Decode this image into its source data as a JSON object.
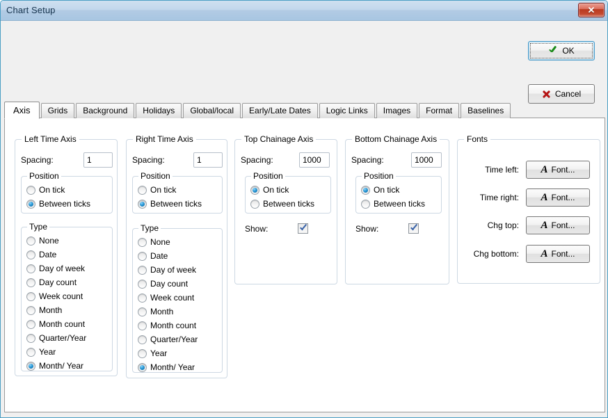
{
  "window": {
    "title": "Chart Setup",
    "close_icon": "close-icon"
  },
  "buttons": {
    "ok": "OK",
    "cancel": "Cancel",
    "ok_icon": "checkmark-icon",
    "cancel_icon": "x-mark-icon"
  },
  "tabs": [
    {
      "label": "Axis",
      "active": true
    },
    {
      "label": "Grids",
      "active": false
    },
    {
      "label": "Background",
      "active": false
    },
    {
      "label": "Holidays",
      "active": false
    },
    {
      "label": "Global/local",
      "active": false
    },
    {
      "label": "Early/Late Dates",
      "active": false
    },
    {
      "label": "Logic Links",
      "active": false
    },
    {
      "label": "Images",
      "active": false
    },
    {
      "label": "Format",
      "active": false
    },
    {
      "label": "Baselines",
      "active": false
    }
  ],
  "common": {
    "spacing_label": "Spacing:",
    "position_legend": "Position",
    "type_legend": "Type",
    "show_label": "Show:",
    "position_options": [
      "On tick",
      "Between ticks"
    ],
    "type_options": [
      "None",
      "Date",
      "Day of week",
      "Day count",
      "Week count",
      "Month",
      "Month count",
      "Quarter/Year",
      "Year",
      "Month/ Year"
    ]
  },
  "left_time_axis": {
    "legend": "Left Time Axis",
    "spacing_value": "1",
    "position_selected": "Between ticks",
    "type_selected": "Month/ Year"
  },
  "right_time_axis": {
    "legend": "Right Time Axis",
    "spacing_value": "1",
    "position_selected": "Between ticks",
    "type_selected": "Month/ Year"
  },
  "top_chainage_axis": {
    "legend": "Top Chainage Axis",
    "spacing_value": "1000",
    "position_selected": "On tick",
    "show_checked": true
  },
  "bottom_chainage_axis": {
    "legend": "Bottom Chainage Axis",
    "spacing_value": "1000",
    "position_selected": "On tick",
    "show_checked": true
  },
  "fonts": {
    "legend": "Fonts",
    "button_label": "Font...",
    "rows": [
      {
        "label": "Time left:"
      },
      {
        "label": "Time right:"
      },
      {
        "label": "Chg top:"
      },
      {
        "label": "Chg bottom:"
      }
    ]
  }
}
